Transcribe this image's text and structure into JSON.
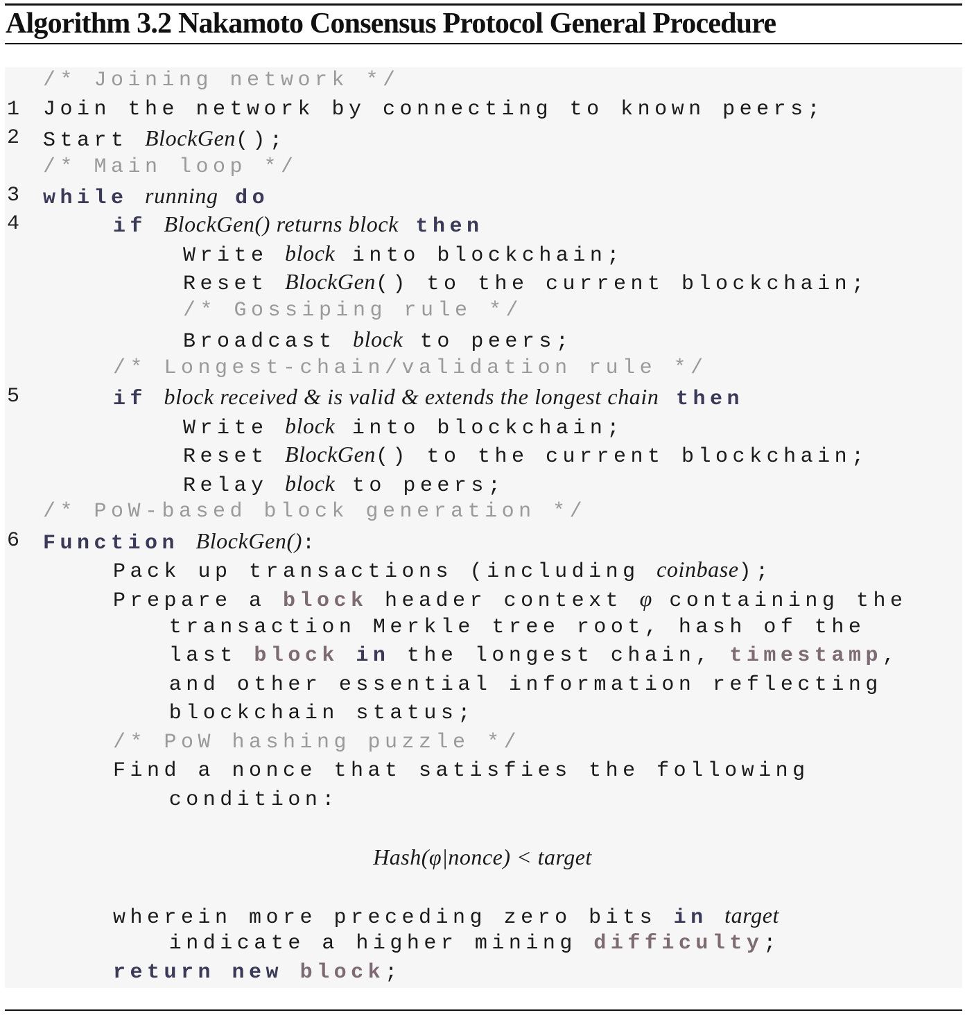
{
  "caption": {
    "label": "Algorithm 3.2",
    "title": "Nakamoto Consensus Protocol General Procedure"
  },
  "lines": [
    {
      "num": "",
      "indent": 0,
      "parts": [
        {
          "t": "/* Joining network */",
          "s": "cm"
        }
      ]
    },
    {
      "num": "1",
      "indent": 0,
      "parts": [
        {
          "t": "Join the network by connecting to known peers;",
          "s": ""
        }
      ]
    },
    {
      "num": "2",
      "indent": 0,
      "parts": [
        {
          "t": "Start ",
          "s": ""
        },
        {
          "t": "BlockGen",
          "s": "it"
        },
        {
          "t": "();",
          "s": ""
        }
      ]
    },
    {
      "num": "",
      "indent": 0,
      "parts": [
        {
          "t": "/* Main loop */",
          "s": "cm"
        }
      ]
    },
    {
      "num": "3",
      "indent": 0,
      "parts": [
        {
          "t": "while",
          "s": "kw"
        },
        {
          "t": " ",
          "s": ""
        },
        {
          "t": "running",
          "s": "it"
        },
        {
          "t": " ",
          "s": ""
        },
        {
          "t": "do",
          "s": "kw"
        }
      ]
    },
    {
      "num": "4",
      "indent": 1,
      "parts": [
        {
          "t": "if",
          "s": "kw"
        },
        {
          "t": " ",
          "s": ""
        },
        {
          "t": "BlockGen() returns block",
          "s": "it"
        },
        {
          "t": " ",
          "s": ""
        },
        {
          "t": "then",
          "s": "kw"
        }
      ]
    },
    {
      "num": "",
      "indent": 2,
      "parts": [
        {
          "t": "Write ",
          "s": ""
        },
        {
          "t": "block",
          "s": "it"
        },
        {
          "t": " into blockchain;",
          "s": ""
        }
      ]
    },
    {
      "num": "",
      "indent": 2,
      "parts": [
        {
          "t": "Reset ",
          "s": ""
        },
        {
          "t": "BlockGen",
          "s": "it"
        },
        {
          "t": "() to the current blockchain;",
          "s": ""
        }
      ]
    },
    {
      "num": "",
      "indent": 2,
      "parts": [
        {
          "t": "/* Gossiping rule */",
          "s": "cm"
        }
      ]
    },
    {
      "num": "",
      "indent": 2,
      "parts": [
        {
          "t": "Broadcast ",
          "s": ""
        },
        {
          "t": "block",
          "s": "it"
        },
        {
          "t": " to peers;",
          "s": ""
        }
      ]
    },
    {
      "num": "",
      "indent": 1,
      "parts": [
        {
          "t": "/* Longest-chain/validation rule */",
          "s": "cm"
        }
      ]
    },
    {
      "num": "5",
      "indent": 1,
      "parts": [
        {
          "t": "if",
          "s": "kw"
        },
        {
          "t": " ",
          "s": ""
        },
        {
          "t": "block received & is valid & extends the longest chain",
          "s": "it"
        },
        {
          "t": " ",
          "s": ""
        },
        {
          "t": "then",
          "s": "kw"
        }
      ]
    },
    {
      "num": "",
      "indent": 2,
      "parts": [
        {
          "t": "Write ",
          "s": ""
        },
        {
          "t": "block",
          "s": "it"
        },
        {
          "t": " into blockchain;",
          "s": ""
        }
      ]
    },
    {
      "num": "",
      "indent": 2,
      "parts": [
        {
          "t": "Reset ",
          "s": ""
        },
        {
          "t": "BlockGen",
          "s": "it"
        },
        {
          "t": "() to the current blockchain;",
          "s": ""
        }
      ]
    },
    {
      "num": "",
      "indent": 2,
      "parts": [
        {
          "t": "Relay ",
          "s": ""
        },
        {
          "t": "block",
          "s": "it"
        },
        {
          "t": " to peers;",
          "s": ""
        }
      ]
    },
    {
      "num": "",
      "indent": 0,
      "parts": [
        {
          "t": "/* PoW-based block generation */",
          "s": "cm"
        }
      ]
    },
    {
      "num": "6",
      "indent": 0,
      "parts": [
        {
          "t": "Function",
          "s": "kw"
        },
        {
          "t": " ",
          "s": ""
        },
        {
          "t": "BlockGen()",
          "s": "it"
        },
        {
          "t": ":",
          "s": ""
        }
      ]
    },
    {
      "num": "",
      "indent": 1,
      "parts": [
        {
          "t": "Pack up transactions (including ",
          "s": ""
        },
        {
          "t": "coinbase",
          "s": "it"
        },
        {
          "t": ");",
          "s": ""
        }
      ]
    },
    {
      "num": "",
      "indent": 1,
      "parts": [
        {
          "t": "Prepare a ",
          "s": ""
        },
        {
          "t": "block",
          "s": "sp"
        },
        {
          "t": " header context ",
          "s": ""
        },
        {
          "t": "φ",
          "s": "it"
        },
        {
          "t": " containing the",
          "s": ""
        }
      ]
    },
    {
      "num": "",
      "indent": 1.8,
      "parts": [
        {
          "t": "transaction Merkle tree root, hash of the",
          "s": ""
        }
      ]
    },
    {
      "num": "",
      "indent": 1.8,
      "parts": [
        {
          "t": "last ",
          "s": ""
        },
        {
          "t": "block",
          "s": "sp"
        },
        {
          "t": " ",
          "s": ""
        },
        {
          "t": "in",
          "s": "kw"
        },
        {
          "t": " the longest chain, ",
          "s": ""
        },
        {
          "t": "timestamp",
          "s": "sp"
        },
        {
          "t": ",",
          "s": ""
        }
      ]
    },
    {
      "num": "",
      "indent": 1.8,
      "parts": [
        {
          "t": "and other essential information reflecting",
          "s": ""
        }
      ]
    },
    {
      "num": "",
      "indent": 1.8,
      "parts": [
        {
          "t": "blockchain status;",
          "s": ""
        }
      ]
    },
    {
      "num": "",
      "indent": 1,
      "parts": [
        {
          "t": "/* PoW hashing puzzle */",
          "s": "cm"
        }
      ]
    },
    {
      "num": "",
      "indent": 1,
      "parts": [
        {
          "t": "Find a nonce that satisfies the following",
          "s": ""
        }
      ]
    },
    {
      "num": "",
      "indent": 1.8,
      "parts": [
        {
          "t": "condition:",
          "s": ""
        }
      ]
    },
    {
      "num": "",
      "indent": 1,
      "parts": [
        {
          "t": "wherein more preceding zero bits ",
          "s": ""
        },
        {
          "t": "in",
          "s": "kw"
        },
        {
          "t": " ",
          "s": ""
        },
        {
          "t": "target",
          "s": "it"
        }
      ]
    },
    {
      "num": "",
      "indent": 1.8,
      "parts": [
        {
          "t": "indicate a higher mining ",
          "s": ""
        },
        {
          "t": "difficulty",
          "s": "sp"
        },
        {
          "t": ";",
          "s": ""
        }
      ]
    },
    {
      "num": "",
      "indent": 1,
      "parts": [
        {
          "t": "return",
          "s": "kw"
        },
        {
          "t": " ",
          "s": ""
        },
        {
          "t": "new",
          "s": "kw"
        },
        {
          "t": " ",
          "s": ""
        },
        {
          "t": "block",
          "s": "sp"
        },
        {
          "t": ";",
          "s": ""
        }
      ]
    }
  ],
  "equation": "Hash(φ|nonce) < target"
}
